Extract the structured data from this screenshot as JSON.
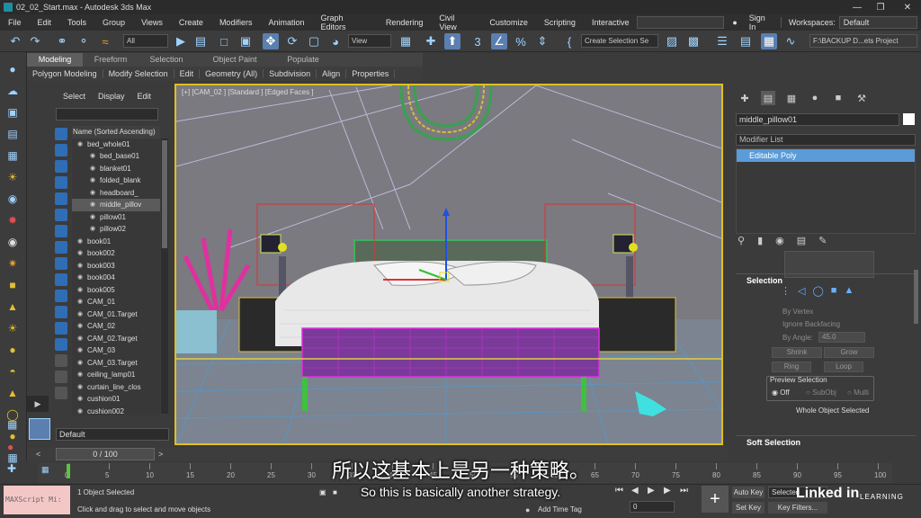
{
  "window": {
    "title": "02_02_Start.max - Autodesk 3ds Max"
  },
  "menu": {
    "items": [
      "File",
      "Edit",
      "Tools",
      "Group",
      "Views",
      "Create",
      "Modifiers",
      "Animation",
      "Graph Editors",
      "Rendering",
      "Civil View",
      "Customize",
      "Scripting",
      "Interactive"
    ],
    "sign_in": "Sign In",
    "workspaces_label": "Workspaces:",
    "workspace_value": "Default"
  },
  "toolbar": {
    "filter_value": "All",
    "refcoord_value": "View",
    "selection_set_value": "Create Selection Se",
    "project_path": "F:\\BACKUP D...ets Project"
  },
  "ribbon": {
    "tabs": [
      "Modeling",
      "Freeform",
      "Selection",
      "Object Paint",
      "Populate"
    ],
    "sub_items": [
      "Polygon Modeling",
      "Modify Selection",
      "Edit",
      "Geometry (All)",
      "Subdivision",
      "Align",
      "Properties"
    ]
  },
  "scene_explorer": {
    "menu": [
      "Select",
      "Display",
      "Edit"
    ],
    "header": "Name (Sorted Ascending)",
    "rows": [
      {
        "label": "bed_whole01",
        "selected": false
      },
      {
        "label": "bed_base01",
        "selected": false
      },
      {
        "label": "blanket01",
        "selected": false
      },
      {
        "label": "folded_blank",
        "selected": false
      },
      {
        "label": "headboard_",
        "selected": false
      },
      {
        "label": "middle_pillov",
        "selected": true
      },
      {
        "label": "pillow01",
        "selected": false
      },
      {
        "label": "pillow02",
        "selected": false
      },
      {
        "label": "book01",
        "selected": false
      },
      {
        "label": "book002",
        "selected": false
      },
      {
        "label": "book003",
        "selected": false
      },
      {
        "label": "book004",
        "selected": false
      },
      {
        "label": "book005",
        "selected": false
      },
      {
        "label": "CAM_01",
        "selected": false
      },
      {
        "label": "CAM_01.Target",
        "selected": false
      },
      {
        "label": "CAM_02",
        "selected": false
      },
      {
        "label": "CAM_02.Target",
        "selected": false
      },
      {
        "label": "CAM_03",
        "selected": false
      },
      {
        "label": "CAM_03.Target",
        "selected": false
      },
      {
        "label": "ceiling_lamp01",
        "selected": false
      },
      {
        "label": "curtain_line_clos",
        "selected": false
      },
      {
        "label": "cushion01",
        "selected": false
      },
      {
        "label": "cushion002",
        "selected": false
      }
    ],
    "layer": "Default"
  },
  "viewport": {
    "label": "[+] [CAM_02 ] [Standard ] [Edged Faces ]"
  },
  "command_panel": {
    "object_name": "middle_pillow01",
    "modifier_list": "Modifier List",
    "stack_item": "Editable Poly",
    "selection_header": "Selection",
    "by_vertex": "By Vertex",
    "ignore_backfacing": "Ignore Backfacing",
    "by_angle": "By Angle:",
    "by_angle_value": "45.0",
    "shrink": "Shrink",
    "grow": "Grow",
    "ring": "Ring",
    "loop": "Loop",
    "preview_selection": "Preview Selection",
    "preview_off": "Off",
    "preview_subobj": "SubObj",
    "preview_multi": "Multi",
    "whole_object_selected": "Whole Object Selected",
    "soft_selection": "Soft Selection"
  },
  "timeline": {
    "slider": "0 / 100",
    "ticks": [
      "0",
      "5",
      "10",
      "15",
      "20",
      "25",
      "30",
      "35",
      "40",
      "45",
      "50",
      "55",
      "60",
      "65",
      "70",
      "75",
      "80",
      "85",
      "90",
      "95",
      "100"
    ]
  },
  "status": {
    "maxscript": "MAXScript Mi:",
    "line1": "1 Object Selected",
    "line2": "Click and drag to select and move objects",
    "add_time_tag": "Add Time Tag",
    "auto_key": "Auto Key",
    "set_key": "Set Key",
    "selected": "Selected",
    "key_filters": "Key Filters...",
    "frame": "0"
  },
  "subtitles": {
    "chinese": "所以这基本上是另一种策略。",
    "english": "So this is basically another strategy."
  },
  "watermark": {
    "brand": "Linked in",
    "tag": "LEARNING"
  }
}
